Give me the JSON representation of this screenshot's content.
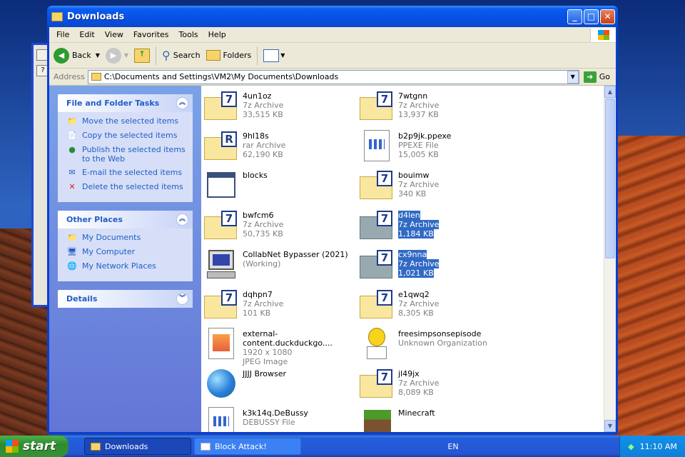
{
  "window": {
    "title": "Downloads"
  },
  "menu": [
    "File",
    "Edit",
    "View",
    "Favorites",
    "Tools",
    "Help"
  ],
  "toolbar": {
    "back": "Back",
    "search": "Search",
    "folders": "Folders"
  },
  "address": {
    "label": "Address",
    "path": "C:\\Documents and Settings\\VM2\\My Documents\\Downloads",
    "go": "Go"
  },
  "side": {
    "file_tasks": {
      "title": "File and Folder Tasks",
      "items": [
        "Move the selected items",
        "Copy the selected items",
        "Publish the selected items to the Web",
        "E-mail the selected items",
        "Delete the selected items"
      ]
    },
    "other_places": {
      "title": "Other Places",
      "items": [
        "My Documents",
        "My Computer",
        "My Network Places"
      ]
    },
    "details": {
      "title": "Details"
    }
  },
  "files": [
    {
      "name": "4un1oz",
      "type": "7z Archive",
      "size": "33,515 KB",
      "icon": "7z"
    },
    {
      "name": "7wtgnn",
      "type": "7z Archive",
      "size": "13,937 KB",
      "icon": "7z"
    },
    {
      "name": "9hl18s",
      "type": "rar Archive",
      "size": "62,190 KB",
      "icon": "rar"
    },
    {
      "name": "b2p9jk.ppexe",
      "type": "PPEXE File",
      "size": "15,005 KB",
      "icon": "doc"
    },
    {
      "name": "blocks",
      "type": "",
      "size": "",
      "icon": "window"
    },
    {
      "name": "bouimw",
      "type": "7z Archive",
      "size": "340 KB",
      "icon": "7z"
    },
    {
      "name": "bwfcm6",
      "type": "7z Archive",
      "size": "50,735 KB",
      "icon": "7z"
    },
    {
      "name": "d4len",
      "type": "7z Archive",
      "size": "1,184 KB",
      "icon": "7z",
      "selected": true
    },
    {
      "name": "CollabNet Bypasser (2021)",
      "type": "(Working)",
      "size": "",
      "icon": "computer"
    },
    {
      "name": "cx9nna",
      "type": "7z Archive",
      "size": "1,021 KB",
      "icon": "7z",
      "selected": true
    },
    {
      "name": "dqhpn7",
      "type": "7z Archive",
      "size": "101 KB",
      "icon": "7z"
    },
    {
      "name": "e1qwq2",
      "type": "7z Archive",
      "size": "8,305 KB",
      "icon": "7z"
    },
    {
      "name": "external-content.duckduckgo....",
      "type": "1920 x 1080",
      "size": "JPEG Image",
      "icon": "image"
    },
    {
      "name": "freesimpsonsepisode",
      "type": "Unknown Organization",
      "size": "",
      "icon": "homer"
    },
    {
      "name": "JJJJ Browser",
      "type": "",
      "size": "",
      "icon": "globe"
    },
    {
      "name": "jl49jx",
      "type": "7z Archive",
      "size": "8,089 KB",
      "icon": "7z"
    },
    {
      "name": "k3k14q.DeBussy",
      "type": "DEBUSSY File",
      "size": "",
      "icon": "doc"
    },
    {
      "name": "Minecraft",
      "type": "",
      "size": "",
      "icon": "minecraft"
    }
  ],
  "taskbar": {
    "start": "start",
    "tasks": [
      "Downloads",
      "Block Attack!"
    ],
    "lang": "EN",
    "clock": "11:10 AM"
  },
  "colors": {
    "title_bar": "#0a5cf0",
    "selection": "#316ac5",
    "link": "#215dc6"
  }
}
